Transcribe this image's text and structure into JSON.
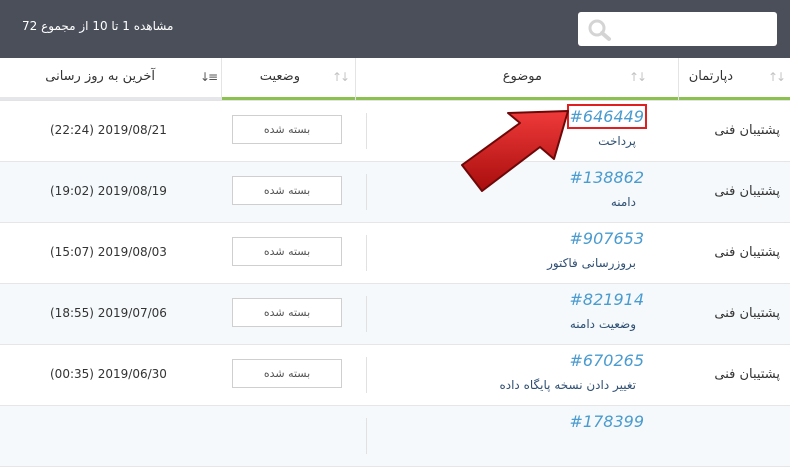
{
  "topbar": {
    "showing_text": "مشاهده 1 تا 10 از مجموع 72",
    "search_placeholder": ""
  },
  "table": {
    "columns": {
      "department": "دپارتمان",
      "subject": "موضوع",
      "status": "وضعیت",
      "last_updated": "آخرین به روز رسانی"
    },
    "rows": [
      {
        "department": "پشتیبان فنی",
        "ticket_id": "#646449",
        "subject": "پرداخت",
        "status": "بسته شده",
        "last_updated": "(22:24) 2019/08/21",
        "highlighted": true
      },
      {
        "department": "پشتیبان فنی",
        "ticket_id": "#138862",
        "subject": "دامنه",
        "status": "بسته شده",
        "last_updated": "(19:02) 2019/08/19"
      },
      {
        "department": "پشتیبان فنی",
        "ticket_id": "#907653",
        "subject": "بروزرسانی فاکتور",
        "status": "بسته شده",
        "last_updated": "(15:07) 2019/08/03"
      },
      {
        "department": "پشتیبان فنی",
        "ticket_id": "#821914",
        "subject": "وضعیت دامنه",
        "status": "بسته شده",
        "last_updated": "(18:55) 2019/07/06"
      },
      {
        "department": "پشتیبان فنی",
        "ticket_id": "#670265",
        "subject": "تغییر دادن نسخه پایگاه داده",
        "status": "بسته شده",
        "last_updated": "(00:35) 2019/06/30"
      },
      {
        "department": "",
        "ticket_id": "#178399",
        "subject": "",
        "status": "",
        "last_updated": ""
      }
    ]
  },
  "colors": {
    "topbar": "#4a4f5a",
    "header_underline": "#8cc152",
    "ticket_link": "#4a9bcf",
    "highlight_box": "#e02020",
    "arrow": "#d11a1a"
  }
}
